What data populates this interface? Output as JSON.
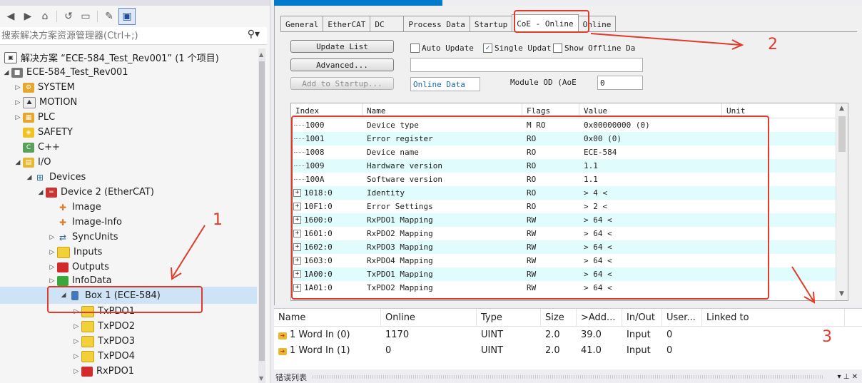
{
  "toolbar": {
    "icons": [
      "back-icon",
      "forward-icon",
      "home-icon",
      "history-icon",
      "view-icon",
      "properties-icon",
      "sync-icon"
    ]
  },
  "search": {
    "placeholder": "搜索解决方案资源管理器(Ctrl+;)"
  },
  "tree": {
    "solution": "解决方案 “ECE-584_Test_Rev001” (1 个项目)",
    "project": "ECE-584_Test_Rev001",
    "system": "SYSTEM",
    "motion": "MOTION",
    "plc": "PLC",
    "safety": "SAFETY",
    "cpp": "C++",
    "io": "I/O",
    "devices": "Devices",
    "device2": "Device 2 (EtherCAT)",
    "image": "Image",
    "image_info": "Image-Info",
    "syncunits": "SyncUnits",
    "inputs": "Inputs",
    "outputs": "Outputs",
    "infodata": "InfoData",
    "box1": "Box 1 (ECE-584)",
    "txpdo1": "TxPDO1",
    "txpdo2": "TxPDO2",
    "txpdo3": "TxPDO3",
    "txpdo4": "TxPDO4",
    "rxpdo1": "RxPDO1"
  },
  "tabs": [
    "General",
    "EtherCAT",
    "DC",
    "Process Data",
    "Startup",
    "CoE - Online",
    "Online"
  ],
  "coe": {
    "update_list": "Update List",
    "advanced": "Advanced...",
    "add_to_startup": "Add to Startup...",
    "auto_update": "Auto Update",
    "single_update": "Single Updat",
    "show_offline": "Show Offline Da",
    "online_data": "Online Data",
    "module_od": "Module OD (AoE",
    "module_od_value": "0"
  },
  "grid": {
    "headers": [
      "Index",
      "Name",
      "Flags",
      "Value",
      "Unit"
    ],
    "rows": [
      {
        "index": "1000",
        "name": "Device type",
        "flags": "M RO",
        "value": "0x00000000 (0)",
        "expand": false
      },
      {
        "index": "1001",
        "name": "Error register",
        "flags": "RO",
        "value": "0x00 (0)",
        "expand": false
      },
      {
        "index": "1008",
        "name": "Device name",
        "flags": "RO",
        "value": "ECE-584",
        "expand": false
      },
      {
        "index": "1009",
        "name": "Hardware version",
        "flags": "RO",
        "value": "1.1",
        "expand": false
      },
      {
        "index": "100A",
        "name": "Software version",
        "flags": "RO",
        "value": "1.1",
        "expand": false
      },
      {
        "index": "1018:0",
        "name": "Identity",
        "flags": "RO",
        "value": "> 4 <",
        "expand": true
      },
      {
        "index": "10F1:0",
        "name": "Error Settings",
        "flags": "RO",
        "value": "> 2 <",
        "expand": true
      },
      {
        "index": "1600:0",
        "name": "RxPDO1 Mapping",
        "flags": "RW",
        "value": "> 64 <",
        "expand": true
      },
      {
        "index": "1601:0",
        "name": "RxPDO2 Mapping",
        "flags": "RW",
        "value": "> 64 <",
        "expand": true
      },
      {
        "index": "1602:0",
        "name": "RxPDO3 Mapping",
        "flags": "RW",
        "value": "> 64 <",
        "expand": true
      },
      {
        "index": "1603:0",
        "name": "RxPDO4 Mapping",
        "flags": "RW",
        "value": "> 64 <",
        "expand": true
      },
      {
        "index": "1A00:0",
        "name": "TxPDO1 Mapping",
        "flags": "RW",
        "value": "> 64 <",
        "expand": true
      },
      {
        "index": "1A01:0",
        "name": "TxPDO2 Mapping",
        "flags": "RW",
        "value": "> 64 <",
        "expand": true
      }
    ]
  },
  "vars": {
    "headers": [
      "Name",
      "Online",
      "Type",
      "Size",
      ">Add...",
      "In/Out",
      "User...",
      "Linked to"
    ],
    "rows": [
      {
        "name": "1 Word In (0)",
        "online": "1170",
        "type": "UINT",
        "size": "2.0",
        "addr": "39.0",
        "inout": "Input",
        "user": "0",
        "linked": ""
      },
      {
        "name": "1 Word In (1)",
        "online": "0",
        "type": "UINT",
        "size": "2.0",
        "addr": "41.0",
        "inout": "Input",
        "user": "0",
        "linked": ""
      }
    ]
  },
  "statusbar": {
    "label": "错误列表"
  },
  "annotations": {
    "n1": "1",
    "n2": "2",
    "n3": "3"
  },
  "colors": {
    "annotation": "#e03a2a",
    "row_alt": "#e0fcfc",
    "accent": "#007acc"
  }
}
